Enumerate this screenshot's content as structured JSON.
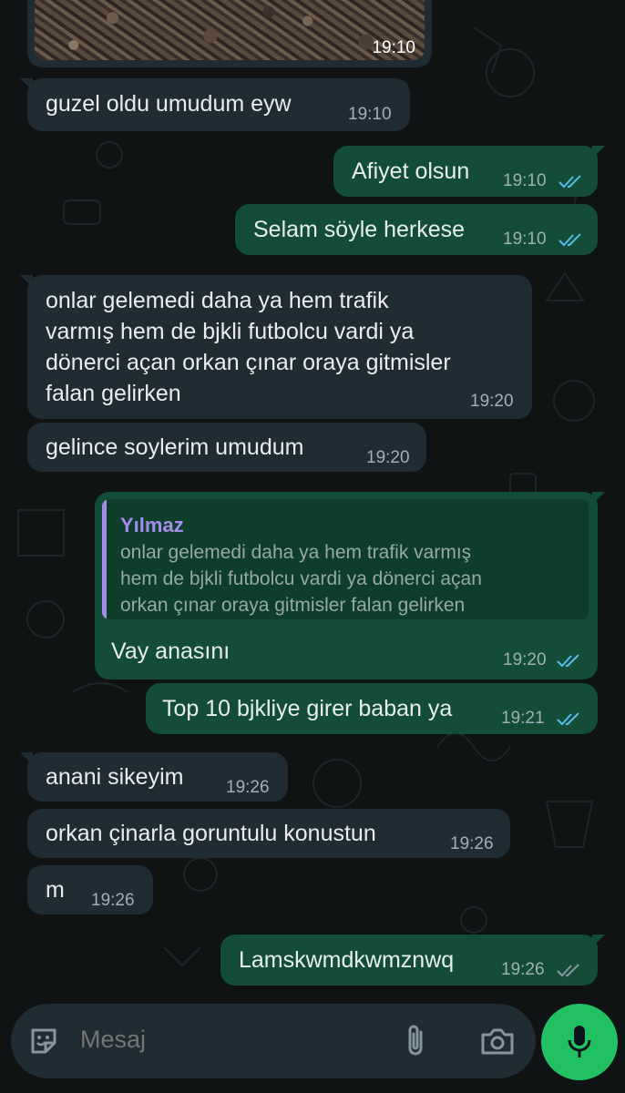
{
  "chat": {
    "photo_time": "19:10",
    "messages": [
      {
        "text": "guzel oldu umudum eyw",
        "time": "19:10"
      },
      {
        "text": "Afiyet olsun",
        "time": "19:10"
      },
      {
        "text": "Selam söyle herkese",
        "time": "19:10"
      },
      {
        "lines": [
          "onlar gelemedi daha ya hem trafik",
          "varmış hem de bjkli futbolcu vardi ya",
          "dönerci açan orkan çınar oraya gitmisler",
          "falan gelirken"
        ],
        "time": "19:20"
      },
      {
        "text": "gelince soylerim umudum",
        "time": "19:20"
      },
      {
        "quote_name": "Yılmaz",
        "quote_lines": [
          "onlar gelemedi daha ya hem trafik varmış",
          "hem de bjkli futbolcu vardi ya dönerci açan",
          "orkan çınar oraya gitmisler falan gelirken"
        ],
        "text": "Vay anasını",
        "time": "19:20"
      },
      {
        "text": "Top 10 bjkliye girer baban ya",
        "time": "19:21"
      },
      {
        "text": "anani sikeyim",
        "time": "19:26"
      },
      {
        "text": "orkan çinarla goruntulu konustun",
        "time": "19:26"
      },
      {
        "text": "m",
        "time": "19:26"
      },
      {
        "text": "Lamskwmdkwmznwq",
        "time": "19:26"
      }
    ]
  },
  "input": {
    "placeholder": "Mesaj"
  },
  "icons": {
    "emoji": "sticker-emoji-icon",
    "attach": "paperclip-icon",
    "camera": "camera-icon",
    "mic": "microphone-icon",
    "read_receipt": "double-check-icon"
  },
  "colors": {
    "background": "#0f1314",
    "incoming_bubble": "#1f2c33",
    "outgoing_bubble": "#134d37",
    "read_tick": "#53bdeb",
    "mic_button": "#21c063",
    "quote_name": "#a58bea"
  }
}
